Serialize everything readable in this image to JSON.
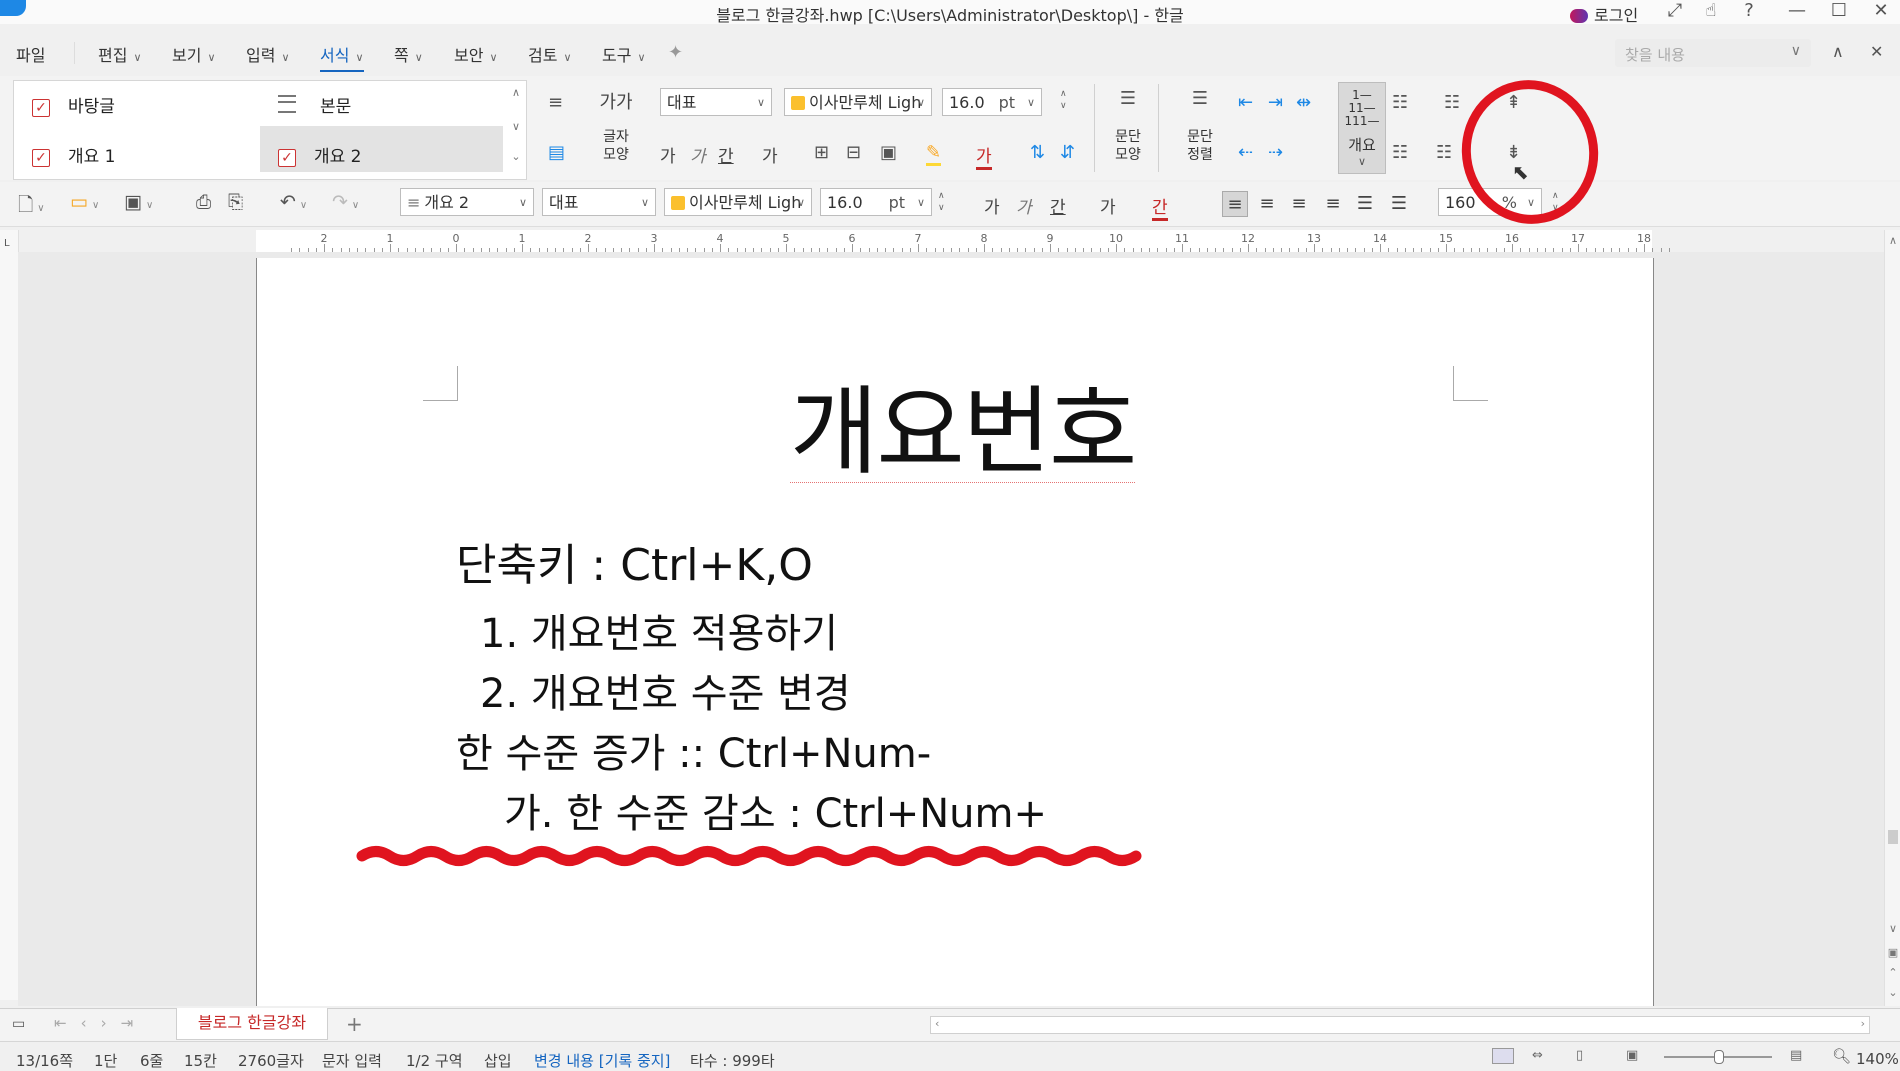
{
  "window": {
    "title": "블로그 한글강좌.hwp [C:\\Users\\Administrator\\Desktop\\] - 한글",
    "login_label": "로그인",
    "help_label": "?"
  },
  "menu": {
    "items": [
      "파일",
      "편집",
      "보기",
      "입력",
      "서식",
      "쪽",
      "보안",
      "검토",
      "도구"
    ],
    "active": "서식",
    "search_placeholder": "찾을 내용"
  },
  "ribbon": {
    "styles": [
      {
        "label": "바탕글"
      },
      {
        "label": "본문"
      },
      {
        "label": "개요 1"
      },
      {
        "label": "개요 2"
      }
    ],
    "char_shape_label": [
      "글자",
      "모양"
    ],
    "char_shape_glyph": "가가",
    "para_shape_label": [
      "문단",
      "모양"
    ],
    "para_align_label": [
      "문단",
      "정렬"
    ],
    "outline_label": "개요",
    "lang_value": "대표",
    "font_value": "이사만루체 Ligh",
    "size_value": "16.0",
    "size_unit": "pt",
    "format_glyphs": [
      "가",
      "가",
      "간",
      "가"
    ]
  },
  "toolbar2": {
    "style_value": "개요 2",
    "lang_value": "대표",
    "font_value": "이사만루체 Ligh",
    "size_value": "16.0",
    "size_unit": "pt",
    "format_glyphs": [
      "가",
      "가",
      "간",
      "가",
      "간"
    ],
    "line_spacing_value": "160",
    "line_spacing_unit": "%"
  },
  "ruler": {
    "numbers": [
      "2",
      "1",
      "0",
      "1",
      "2",
      "3",
      "4",
      "5",
      "6",
      "7",
      "8",
      "9",
      "10",
      "11",
      "12",
      "13",
      "14",
      "15",
      "16",
      "17",
      "18"
    ]
  },
  "document": {
    "heading": "개요번호",
    "lines": [
      "단축키 : Ctrl+K,O",
      "1. 개요번호 적용하기",
      "2. 개요번호 수준 변경",
      "한 수준 증가 :: Ctrl+Num-",
      "가. 한 수준 감소 : Ctrl+Num+"
    ]
  },
  "tabs": {
    "doc_tab": "블로그 한글강좌",
    "add_label": "+"
  },
  "status": {
    "page": "13/16쪽",
    "column": "1단",
    "line": "6줄",
    "col": "15칸",
    "chars": "2760글자",
    "mode": "문자 입력",
    "section": "1/2 구역",
    "insert": "삽입",
    "track": "변경 내용 [기록 중지]",
    "stroke": "타수 : 999타",
    "zoom": "140%"
  },
  "colors": {
    "accent": "#1565c0",
    "annotation": "#e0141f",
    "tab_text": "#c62828"
  }
}
